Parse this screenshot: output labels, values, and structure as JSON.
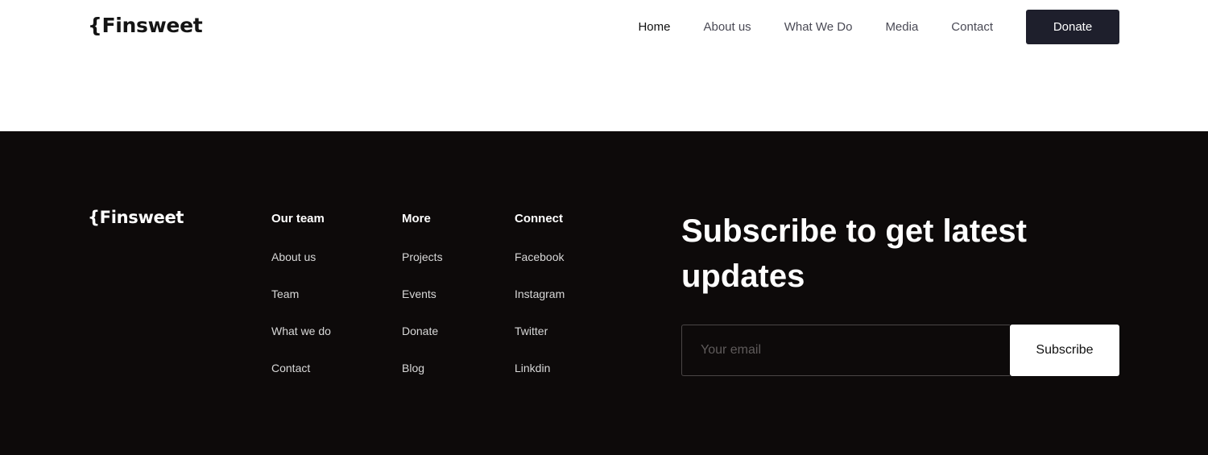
{
  "header": {
    "logo": "{Finsweet",
    "nav": [
      {
        "label": "Home",
        "active": true
      },
      {
        "label": "About us"
      },
      {
        "label": "What We Do"
      },
      {
        "label": "Media"
      },
      {
        "label": "Contact"
      }
    ],
    "donate_label": "Donate"
  },
  "footer": {
    "logo": "{Finsweet",
    "columns": [
      {
        "title": "Our team",
        "links": [
          "About us",
          "Team",
          "What we do",
          "Contact"
        ]
      },
      {
        "title": "More",
        "links": [
          "Projects",
          "Events",
          "Donate",
          "Blog"
        ]
      },
      {
        "title": "Connect",
        "links": [
          "Facebook",
          "Instagram",
          "Twitter",
          "Linkdin"
        ]
      }
    ],
    "subscribe": {
      "title": "Subscribe to get latest updates",
      "placeholder": "Your email",
      "button": "Subscribe"
    }
  },
  "colors": {
    "footer_bg": "#0d0a0a",
    "donate_bg": "#1e1f2c",
    "text_dark": "#141414"
  }
}
